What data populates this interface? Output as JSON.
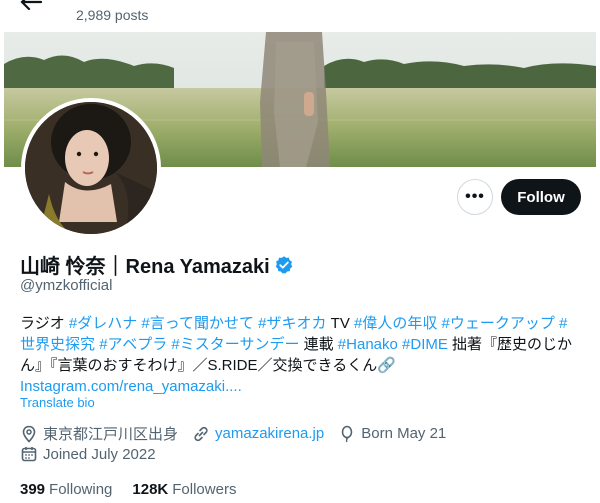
{
  "header": {
    "back_label": "Back",
    "posts_count": "2,989 posts"
  },
  "profile": {
    "display_name": "山崎 怜奈｜Rena Yamazaki",
    "handle": "@ymzkofficial",
    "more_label": "•••",
    "follow_label": "Follow"
  },
  "bio": {
    "line1_prefix": "ラジオ ",
    "tags_a": [
      "#ダレハナ",
      "#言って聞かせて",
      "#ザキオカ"
    ],
    "line1_tv": " TV ",
    "tags_b": [
      "#偉人の年収",
      "#ウェークアップ",
      "#"
    ],
    "line2_tags": [
      "世界史探究",
      "#アベプラ",
      "#ミスターサンデー"
    ],
    "line2_serial": " 連載 ",
    "line2_tags_c": [
      "#Hanako",
      "#DIME"
    ],
    "line2_suffix": " 拙著『歴史のじか",
    "line3": "ん』『言葉のおすそわけ』／S.RIDE／交換できるくん",
    "line3_icon": "🔗",
    "link": "Instagram.com/rena_yamazaki....",
    "translate_label": "Translate bio"
  },
  "meta": {
    "location": "東京都江戸川区出身",
    "website": "yamazakirena.jp",
    "birthday": "Born May 21",
    "joined": "Joined July 2022"
  },
  "stats": {
    "following_count": "399",
    "following_label": "Following",
    "followers_count": "128K",
    "followers_label": "Followers"
  },
  "icons": {
    "back": "arrow-left-icon",
    "verified": "verified-badge-icon",
    "location": "location-pin-icon",
    "link": "link-icon",
    "birthday": "balloon-icon",
    "calendar": "calendar-icon"
  },
  "colors": {
    "accent": "#1d9bf0",
    "text": "#0f1419",
    "muted": "#536471",
    "follow_bg": "#0f1419"
  }
}
